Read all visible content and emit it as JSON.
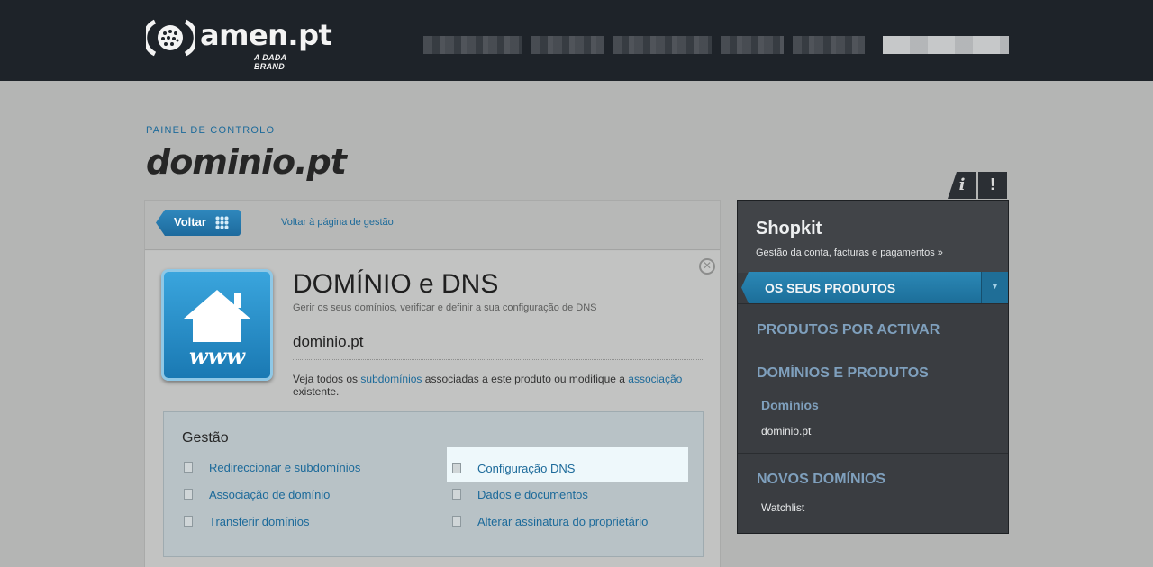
{
  "header": {
    "logo_text": "amen.pt",
    "logo_sub": "A DADA BRAND",
    "logo_icon": "globe-logo-icon"
  },
  "page": {
    "eyebrow": "PAINEL DE CONTROLO",
    "title": "dominio.pt"
  },
  "panel": {
    "back_label": "Voltar",
    "back_link": "Voltar à página de gestão",
    "card_title": "DOMÍNIO e DNS",
    "card_subtitle": "Gerir os seus domínios, verificar e definir a sua configuração de DNS",
    "domain": "dominio.pt",
    "desc_pre": "Veja todos os ",
    "desc_link1": "subdomínios",
    "desc_mid": " associadas a este produto ou modifique a ",
    "desc_link2": "associação",
    "desc_post": " existente.",
    "icon_text": "www",
    "gestao": {
      "title": "Gestão",
      "items": [
        "Redireccionar e subdomínios",
        "Configuração DNS",
        "Associação de domínio",
        "Dados e documentos",
        "Transferir domínios",
        "Alterar assinatura do proprietário"
      ]
    }
  },
  "sidebar": {
    "tab_info": "i",
    "tab_alert": "!",
    "title": "Shopkit",
    "subtitle": "Gestão da conta, facturas e pagamentos »",
    "active": "OS SEUS PRODUTOS",
    "section1": "PRODUTOS POR ACTIVAR",
    "section2": "DOMÍNIOS E PRODUTOS",
    "section2_sub": "Domínios",
    "section2_leaf": "dominio.pt",
    "section3": "NOVOS DOMÍNIOS",
    "section3_leaf": "Watchlist"
  },
  "colors": {
    "accent": "#1c6a9a",
    "topbar": "#1e2329",
    "sidebar": "#3a3d41"
  }
}
